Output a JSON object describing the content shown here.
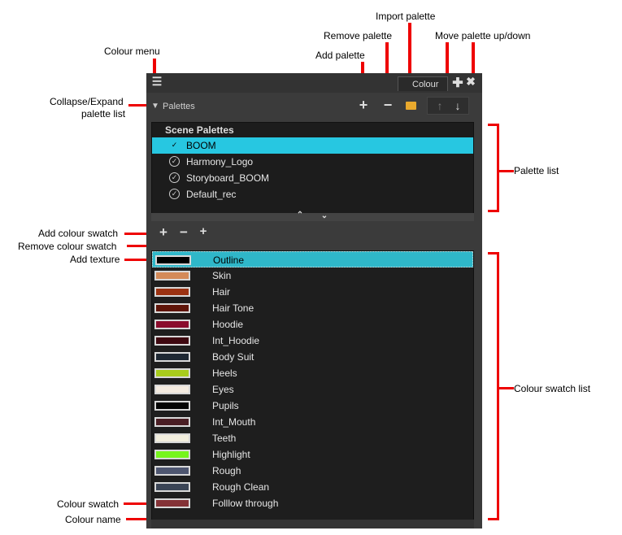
{
  "annotations": {
    "colour_menu": "Colour menu",
    "collapse_expand": [
      "Collapse/Expand",
      "palette list"
    ],
    "add_palette": "Add palette",
    "remove_palette": "Remove palette",
    "import_palette": "Import palette",
    "move_palette": "Move palette up/down",
    "palette_list": "Palette list",
    "add_colour_swatch": "Add colour swatch",
    "remove_colour_swatch": "Remove colour swatch",
    "add_texture": "Add texture",
    "colour_swatch_list": "Colour swatch list",
    "colour_swatch": "Colour swatch",
    "colour_name": "Colour name"
  },
  "panel": {
    "tab_label": "Colour",
    "palettes_toggle": "Palettes",
    "icons": {
      "menu": "hamburger-menu-icon",
      "add_palette": "plus-icon",
      "remove_palette": "minus-icon",
      "import_palette": "folder-icon",
      "move_up": "arrow-up-icon",
      "move_down": "arrow-down-icon",
      "add_swatch": "plus-icon",
      "remove_swatch": "minus-icon",
      "add_texture": "texture-plus-icon"
    }
  },
  "palette_list": {
    "header": "Scene Palettes",
    "items": [
      {
        "name": "BOOM",
        "selected": true
      },
      {
        "name": "Harmony_Logo",
        "selected": false
      },
      {
        "name": "Storyboard_BOOM",
        "selected": false
      },
      {
        "name": "Default_rec",
        "selected": false
      }
    ]
  },
  "swatches": [
    {
      "name": "Outline",
      "color": "#000000",
      "selected": true
    },
    {
      "name": "Skin",
      "color": "#d48a58",
      "selected": false
    },
    {
      "name": "Hair",
      "color": "#9b3212",
      "selected": false
    },
    {
      "name": "Hair Tone",
      "color": "#5e1408",
      "selected": false
    },
    {
      "name": "Hoodie",
      "color": "#8a0c2c",
      "selected": false
    },
    {
      "name": "Int_Hoodie",
      "color": "#3e0810",
      "selected": false
    },
    {
      "name": "Body Suit",
      "color": "#1e2833",
      "selected": false
    },
    {
      "name": "Heels",
      "color": "#a8cc1c",
      "selected": false
    },
    {
      "name": "Eyes",
      "color": "#f4ebe0",
      "selected": false
    },
    {
      "name": "Pupils",
      "color": "#050505",
      "selected": false
    },
    {
      "name": "Int_Mouth",
      "color": "#4a1e24",
      "selected": false
    },
    {
      "name": "Teeth",
      "color": "#f2eedd",
      "selected": false
    },
    {
      "name": "Highlight",
      "color": "#76f51c",
      "selected": false
    },
    {
      "name": "Rough",
      "color": "#4e5670",
      "selected": false
    },
    {
      "name": "Rough Clean",
      "color": "#3a4455",
      "selected": false
    },
    {
      "name": "Folllow through",
      "color": "#843236",
      "selected": false
    }
  ]
}
